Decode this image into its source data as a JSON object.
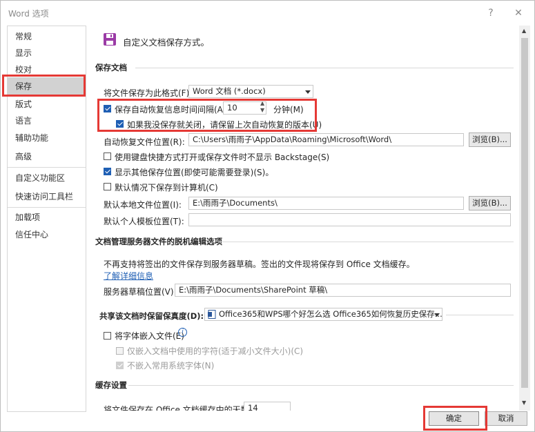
{
  "window": {
    "title": "Word 选项",
    "help_label": "?",
    "close_label": "✕"
  },
  "sidebar": {
    "items": [
      {
        "label": "常规"
      },
      {
        "label": "显示"
      },
      {
        "label": "校对"
      },
      {
        "label": "保存"
      },
      {
        "label": "版式"
      },
      {
        "label": "语言"
      },
      {
        "label": "辅助功能"
      },
      {
        "label": "高级"
      },
      {
        "label": "自定义功能区"
      },
      {
        "label": "快速访问工具栏"
      },
      {
        "label": "加载项"
      },
      {
        "label": "信任中心"
      }
    ],
    "selected": "保存"
  },
  "header": {
    "icon": "save-icon",
    "text": "自定义文档保存方式。"
  },
  "save_docs": {
    "heading": "保存文档",
    "format_label": "将文件保存为此格式(F):",
    "format_value": "Word 文档 (*.docx)",
    "autorecover_label": "保存自动恢复信息时间间隔(A)",
    "autorecover_value": "10",
    "minutes_label": "分钟(M)",
    "keep_last_label": "如果我没保存就关闭，请保留上次自动恢复的版本(U)",
    "autorecover_path_label": "自动恢复文件位置(R):",
    "autorecover_path": "C:\\Users\\雨雨子\\AppData\\Roaming\\Microsoft\\Word\\",
    "browse_label": "浏览(B)...",
    "backstage_label": "使用键盘快捷方式打开或保存文件时不显示 Backstage(S)",
    "show_more_label": "显示其他保存位置(即使可能需要登录)(S)。",
    "save_to_computer_label": "默认情况下保存到计算机(C)",
    "local_path_label": "默认本地文件位置(I):",
    "local_path": "E:\\雨雨子\\Documents\\",
    "template_label": "默认个人模板位置(T):",
    "template_path": ""
  },
  "offline": {
    "heading": "文档管理服务器文件的脱机编辑选项",
    "note": "不再支持将签出的文件保存到服务器草稿。签出的文件现将保存到 Office 文档缓存。",
    "link": "了解详细信息",
    "drafts_label": "服务器草稿位置(V):",
    "drafts_path": "E:\\雨雨子\\Documents\\SharePoint 草稿\\"
  },
  "fidelity": {
    "label": "共享该文档时保留保真度(D):",
    "doc_value": "Office365和WPS哪个好怎么选 Office365如何恢复历史保存...",
    "embed_fonts_label": "将字体嵌入文件(E)",
    "info_icon": "info-icon",
    "embed_used_label": "仅嵌入文档中使用的字符(适于减小文件大小)(C)",
    "no_common_label": "不嵌入常用系统字体(N)"
  },
  "cache": {
    "heading": "缓存设置",
    "days_label": "将文件保存在 Office 文档缓存中的天数:",
    "days_value": "14"
  },
  "checks": {
    "autorecover": true,
    "keep_last": true,
    "backstage": false,
    "show_more": true,
    "save_to_computer": false,
    "embed_fonts": false,
    "embed_used": false,
    "no_common": true
  },
  "footer": {
    "ok_label": "确定",
    "cancel_label": "取消"
  },
  "colors": {
    "highlight": "#e53935",
    "check_blue": "#1f5fb4",
    "save_icon": "#9b3ba6"
  }
}
